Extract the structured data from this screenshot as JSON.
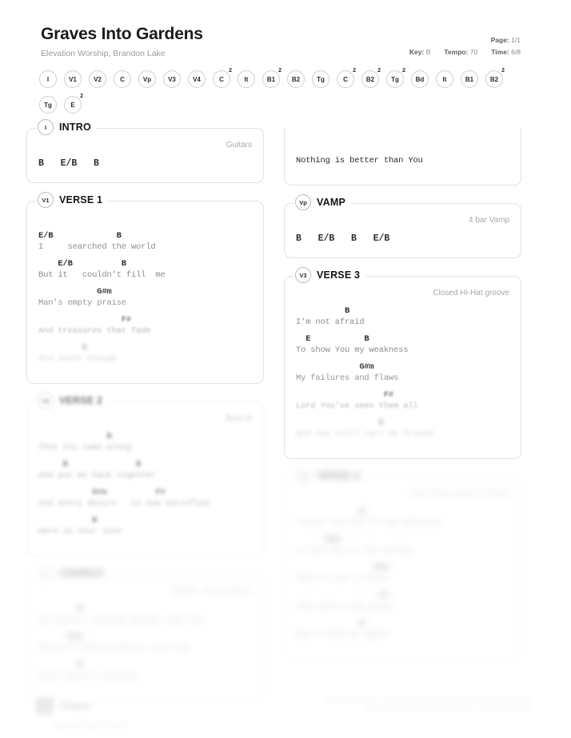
{
  "header": {
    "title": "Graves Into Gardens",
    "artist": "Elevation Worship, Brandon Lake",
    "page_label": "Page:",
    "page_value": "1/1",
    "key_label": "Key:",
    "key_value": "B",
    "tempo_label": "Tempo:",
    "tempo_value": "70",
    "time_label": "Time:",
    "time_value": "6/8"
  },
  "arrangement": [
    {
      "label": "I",
      "sup": ""
    },
    {
      "label": "V1",
      "sup": ""
    },
    {
      "label": "V2",
      "sup": ""
    },
    {
      "label": "C",
      "sup": ""
    },
    {
      "label": "Vp",
      "sup": ""
    },
    {
      "label": "V3",
      "sup": ""
    },
    {
      "label": "V4",
      "sup": ""
    },
    {
      "label": "C",
      "sup": "2"
    },
    {
      "label": "It",
      "sup": ""
    },
    {
      "label": "B1",
      "sup": "2"
    },
    {
      "label": "B2",
      "sup": ""
    },
    {
      "label": "Tg",
      "sup": ""
    },
    {
      "label": "C",
      "sup": "2"
    },
    {
      "label": "B2",
      "sup": "2"
    },
    {
      "label": "Tg",
      "sup": "2"
    },
    {
      "label": "Bd",
      "sup": ""
    },
    {
      "label": "It",
      "sup": ""
    },
    {
      "label": "B1",
      "sup": ""
    },
    {
      "label": "B2",
      "sup": "2"
    },
    {
      "label": "Tg",
      "sup": ""
    },
    {
      "label": "E",
      "sup": "2"
    }
  ],
  "left_column": {
    "intro": {
      "badge": "I",
      "name": "INTRO",
      "note": "Guitars",
      "chords": "B   E/B   B"
    },
    "verse1": {
      "badge": "V1",
      "name": "VERSE 1",
      "note": "",
      "lines": [
        {
          "chords": "E/B             B",
          "lyrics": "I     searched the world"
        },
        {
          "chords": "    E/B          B",
          "lyrics": "But it   couldn't fill  me"
        },
        {
          "chords": "            G#m",
          "lyrics": "Man's empty praise"
        },
        {
          "chords": "                 F#",
          "lyrics": "And treasures that fade"
        },
        {
          "chords": "         E",
          "lyrics": "Are never enough"
        }
      ]
    },
    "verse2": {
      "badge": "V2",
      "name": "VERSE 2",
      "note": "Bass in",
      "lines": [
        {
          "chords": "              B",
          "lyrics": "Then You came along"
        },
        {
          "chords": "     B              B",
          "lyrics": "And put me back together"
        },
        {
          "chords": "           G#m          F#",
          "lyrics": "And every desire   is now satisfied"
        },
        {
          "chords": "           B",
          "lyrics": "Here in Your love"
        }
      ]
    },
    "chorus": {
      "badge": "C",
      "name": "CHORUS",
      "note": "Bigger - drums tighten",
      "lines": [
        {
          "chords": "        B",
          "lyrics": "Oh there's nothing better than You"
        },
        {
          "chords": "      G#m",
          "lyrics": "There's nothing better than You"
        },
        {
          "chords": "        B",
          "lyrics": "Lord there's nothing"
        }
      ]
    }
  },
  "right_column": {
    "continued": {
      "badge": "",
      "name": "",
      "note": "",
      "lines": [
        {
          "chords": "",
          "lyrics": "Nothing is better than You"
        }
      ]
    },
    "vamp": {
      "badge": "Vp",
      "name": "VAMP",
      "note": "4 bar Vamp",
      "chords": "B   E/B   B   E/B"
    },
    "verse3": {
      "badge": "V3",
      "name": "VERSE 3",
      "note": "Closed Hi-Hat groove",
      "lines": [
        {
          "chords": "          B",
          "lyrics": "I'm not afraid"
        },
        {
          "chords": "  E           B",
          "lyrics": "To show You my weakness"
        },
        {
          "chords": "             G#m",
          "lyrics": "My failures and flaws"
        },
        {
          "chords": "                  F#",
          "lyrics": "Lord You've seen them all"
        },
        {
          "chords": "                 E",
          "lyrics": "And You still call me friend"
        }
      ]
    },
    "verse4": {
      "badge": "V4",
      "name": "VERSE 4",
      "note": "Last Chorus build to Chorus",
      "lines": [
        {
          "chords": "             B",
          "lyrics": "'Cause the God of the mountain"
        },
        {
          "chords": "      G#m",
          "lyrics": "Is the God of the valley"
        },
        {
          "chords": "                G#m",
          "lyrics": "There's not a place"
        },
        {
          "chords": "                 F#",
          "lyrics": "Your mercy and grace"
        },
        {
          "chords": "             B",
          "lyrics": "Won't find me again"
        }
      ]
    }
  },
  "footer": {
    "brand": "Charts",
    "url": "www.worshiponline.com",
    "credit_line1": "Graves Into Gardens - Chris Brown, Steven Furtick, Brandon Lake, Tiffany Hudson",
    "credit_line2": "2019 Music by Elevation Worship Publishing - CCLI Song #7138219"
  }
}
